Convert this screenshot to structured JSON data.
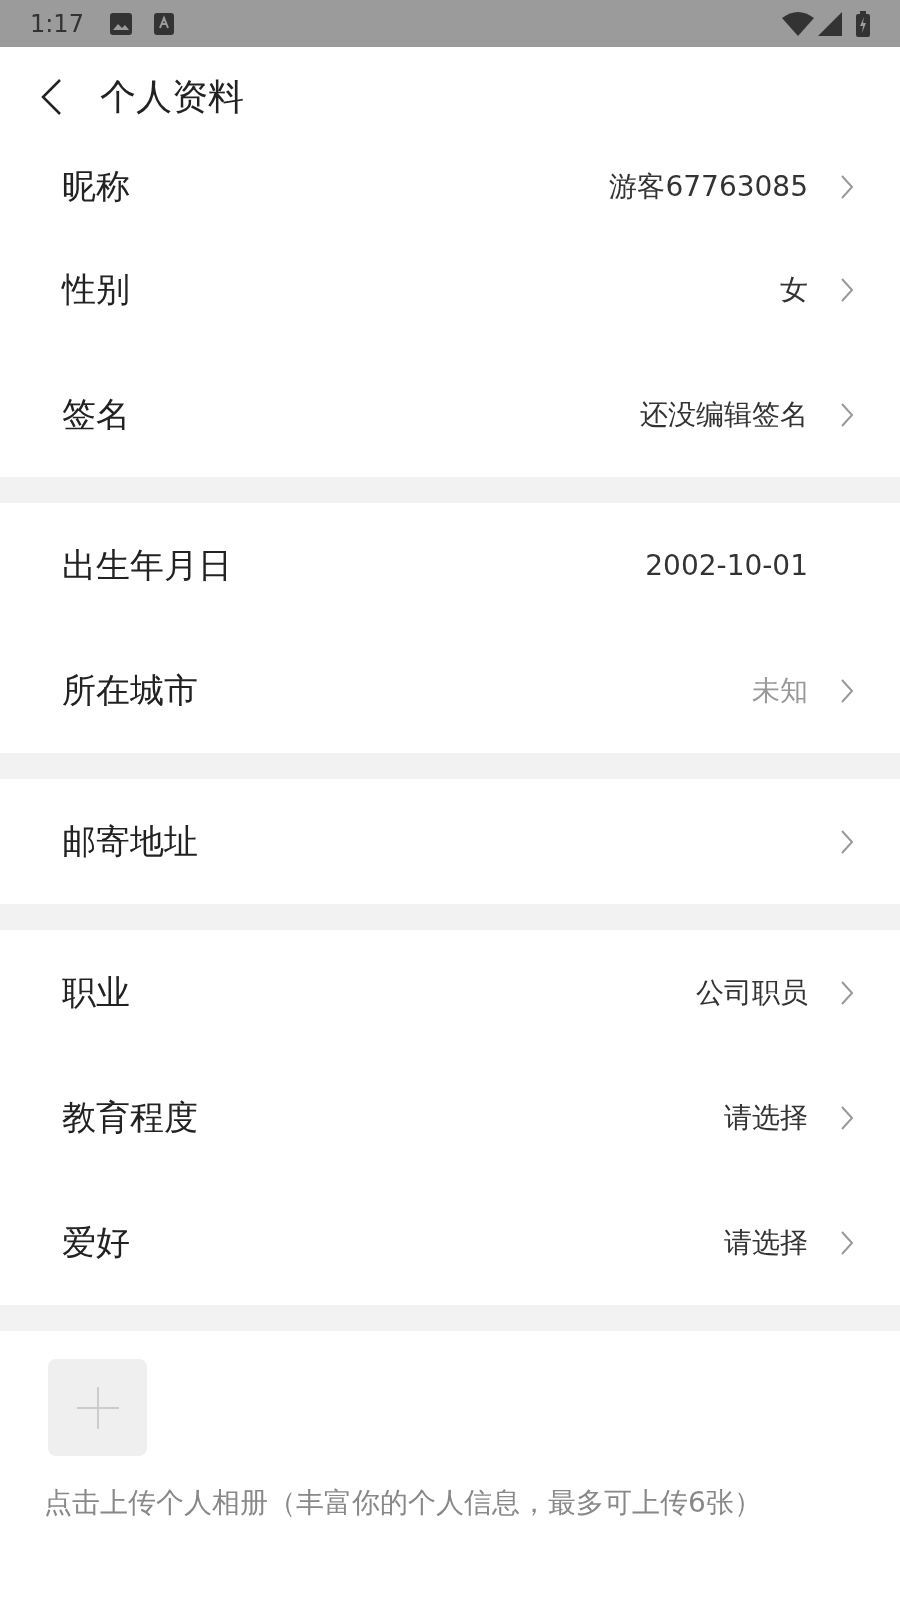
{
  "status_bar": {
    "time": "1:17"
  },
  "header": {
    "title": "个人资料"
  },
  "groups": [
    {
      "rows": [
        {
          "label": "昵称",
          "value": "游客67763085",
          "muted": false,
          "arrow": true
        },
        {
          "label": "性别",
          "value": "女",
          "muted": false,
          "arrow": true
        },
        {
          "label": "签名",
          "value": "还没编辑签名",
          "muted": false,
          "arrow": true
        }
      ]
    },
    {
      "rows": [
        {
          "label": "出生年月日",
          "value": "2002-10-01",
          "muted": false,
          "arrow": false
        },
        {
          "label": "所在城市",
          "value": "未知",
          "muted": true,
          "arrow": true
        }
      ]
    },
    {
      "rows": [
        {
          "label": "邮寄地址",
          "arrow": true
        }
      ]
    },
    {
      "rows": [
        {
          "label": "职业",
          "value": "公司职员",
          "muted": false,
          "arrow": true
        },
        {
          "label": "教育程度",
          "value": "请选择",
          "muted": false,
          "arrow": true
        },
        {
          "label": "爱好",
          "value": "请选择",
          "muted": false,
          "arrow": true
        }
      ]
    }
  ],
  "album": {
    "hint": "点击上传个人相册（丰富你的个人信息，最多可上传6张）"
  }
}
